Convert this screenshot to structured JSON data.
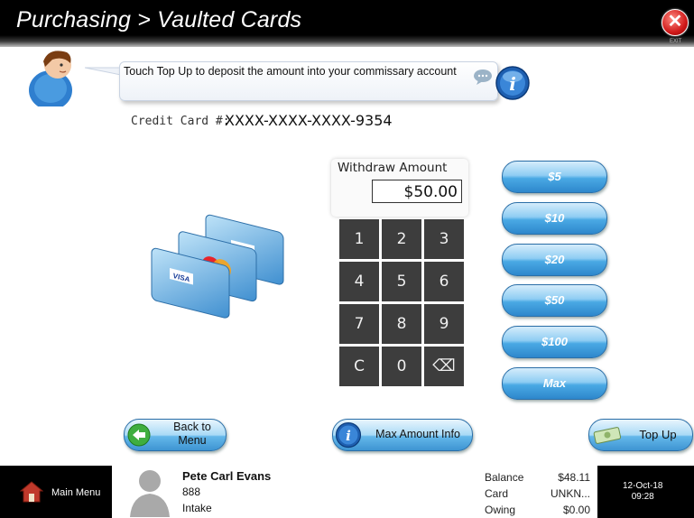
{
  "header": {
    "title": "Purchasing > Vaulted Cards",
    "exit_label": "EXIT"
  },
  "help": {
    "text": "Touch Top Up to deposit the amount into your commissary account"
  },
  "credit_card": {
    "label": "Credit Card #:",
    "number": "XXXX-XXXX-XXXX-9354"
  },
  "withdraw": {
    "label": "Withdraw Amount",
    "value": "$50.00"
  },
  "keypad": {
    "keys": [
      "1",
      "2",
      "3",
      "4",
      "5",
      "6",
      "7",
      "8",
      "9",
      "C",
      "0"
    ],
    "backspace_glyph": "⌫"
  },
  "presets": [
    "$5",
    "$10",
    "$20",
    "$50",
    "$100",
    "Max"
  ],
  "actions": {
    "back_line1": "Back to",
    "back_line2": "Menu",
    "max_info": "Max Amount Info",
    "top_up": "Top Up"
  },
  "footer": {
    "main_menu": "Main Menu",
    "user": {
      "name": "Pete Carl Evans",
      "id": "888",
      "location": "Intake"
    },
    "account": [
      {
        "label": "Balance",
        "value": "$48.11"
      },
      {
        "label": "Card",
        "value": "UNKN..."
      },
      {
        "label": "Owing",
        "value": "$0.00"
      }
    ],
    "date": "12-Oct-18",
    "time": "09:28"
  },
  "icons": [
    "exit-icon",
    "guide-avatar-icon",
    "chat-bubble-icon",
    "info-icon",
    "credit-cards-icon",
    "back-arrow-icon",
    "money-icon",
    "home-icon",
    "user-photo-icon"
  ],
  "colors": {
    "header_bg": "#000000",
    "button_blue": "#4aa9e4",
    "keypad": "#3d3d3d",
    "exit_red": "#d11a1a"
  }
}
